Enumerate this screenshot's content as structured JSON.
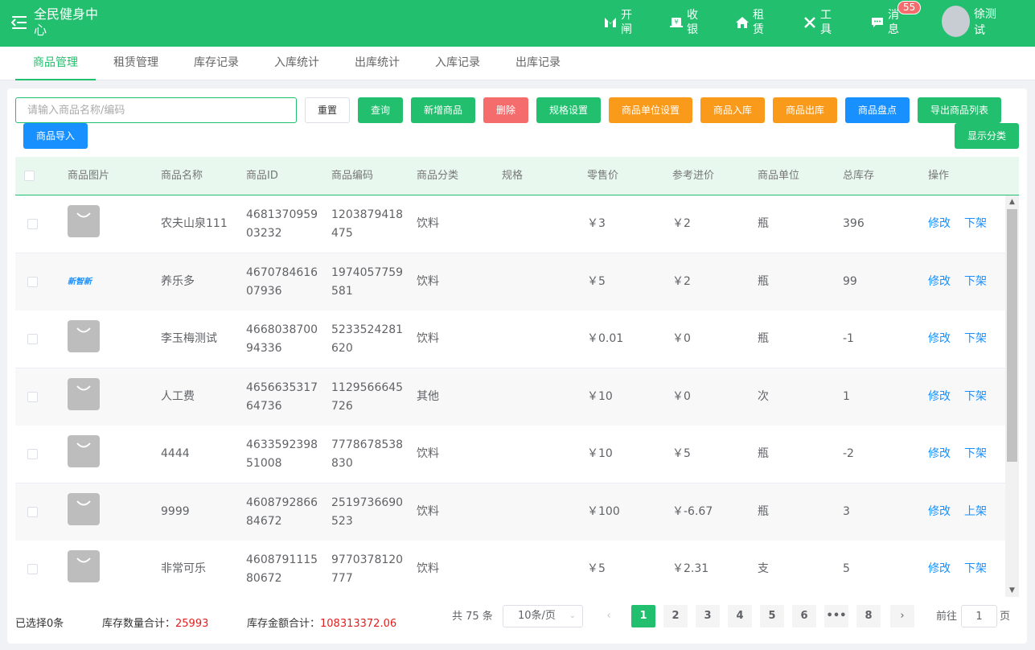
{
  "header": {
    "title": "全民健身中心",
    "nav": [
      {
        "label": "开闸",
        "icon": "gate-icon"
      },
      {
        "label": "收银",
        "icon": "cashier-icon"
      },
      {
        "label": "租赁",
        "icon": "home-icon"
      },
      {
        "label": "工具",
        "icon": "tools-icon"
      },
      {
        "label": "消息",
        "icon": "message-icon"
      }
    ],
    "message_badge": "55",
    "user_name": "徐测试"
  },
  "tabs": [
    {
      "label": "商品管理",
      "active": true
    },
    {
      "label": "租赁管理"
    },
    {
      "label": "库存记录"
    },
    {
      "label": "入库统计"
    },
    {
      "label": "出库统计"
    },
    {
      "label": "入库记录"
    },
    {
      "label": "出库记录"
    }
  ],
  "toolbar": {
    "search_placeholder": "请输入商品名称/编码",
    "search_value": "",
    "reset": "重置",
    "query": "查询",
    "add": "新增商品",
    "delete": "删除",
    "spec": "规格设置",
    "unit": "商品单位设置",
    "stock_in": "商品入库",
    "stock_out": "商品出库",
    "inventory": "商品盘点",
    "export": "导出商品列表",
    "import": "商品导入",
    "show_category": "显示分类"
  },
  "table": {
    "columns": [
      "商品图片",
      "商品名称",
      "商品ID",
      "商品编码",
      "商品分类",
      "规格",
      "零售价",
      "参考进价",
      "商品单位",
      "总库存",
      "操作"
    ],
    "rows": [
      {
        "name": "农夫山泉111",
        "id": "468137095903232",
        "code": "1203879418475",
        "category": "饮料",
        "spec": "",
        "price": "￥3",
        "cost": "￥2",
        "unit": "瓶",
        "stock": "396",
        "edit": "修改",
        "shelf": "下架",
        "img": "bag"
      },
      {
        "name": "养乐多",
        "id": "467078461607936",
        "code": "1974057759581",
        "category": "饮料",
        "spec": "",
        "price": "￥5",
        "cost": "￥2",
        "unit": "瓶",
        "stock": "99",
        "edit": "修改",
        "shelf": "下架",
        "img": "logo",
        "logo_text": "新智新"
      },
      {
        "name": "李玉梅测试",
        "id": "466803870094336",
        "code": "5233524281620",
        "category": "饮料",
        "spec": "",
        "price": "￥0.01",
        "cost": "￥0",
        "unit": "瓶",
        "stock": "-1",
        "edit": "修改",
        "shelf": "下架",
        "img": "bag"
      },
      {
        "name": "人工费",
        "id": "465663531764736",
        "code": "1129566645726",
        "category": "其他",
        "spec": "",
        "price": "￥10",
        "cost": "￥0",
        "unit": "次",
        "stock": "1",
        "edit": "修改",
        "shelf": "下架",
        "img": "bag"
      },
      {
        "name": "4444",
        "id": "463359239851008",
        "code": "7778678538830",
        "category": "饮料",
        "spec": "",
        "price": "￥10",
        "cost": "￥5",
        "unit": "瓶",
        "stock": "-2",
        "edit": "修改",
        "shelf": "下架",
        "img": "bag"
      },
      {
        "name": "9999",
        "id": "460879286684672",
        "code": "2519736690523",
        "category": "饮料",
        "spec": "",
        "price": "￥100",
        "cost": "￥-6.67",
        "unit": "瓶",
        "stock": "3",
        "edit": "修改",
        "shelf": "上架",
        "img": "bag"
      },
      {
        "name": "非常可乐",
        "id": "460879111580672",
        "code": "9770378120777",
        "category": "饮料",
        "spec": "",
        "price": "￥5",
        "cost": "￥2.31",
        "unit": "支",
        "stock": "5",
        "edit": "修改",
        "shelf": "下架",
        "img": "bag"
      }
    ]
  },
  "footer": {
    "selected": "已选择0条",
    "qty_label": "库存数量合计：",
    "qty_value": "25993",
    "amount_label": "库存金额合计：",
    "amount_value": "108313372.06"
  },
  "pagination": {
    "total": "共 75 条",
    "page_size": "10条/页",
    "pages": [
      "1",
      "2",
      "3",
      "4",
      "5",
      "6",
      "•••",
      "8"
    ],
    "current": "1",
    "goto_label": "前往",
    "goto_value": "1",
    "goto_suffix": "页"
  },
  "colors": {
    "primary": "#22bf6e",
    "danger": "#f56c6c",
    "warning": "#fa9a1b",
    "info": "#1890ff"
  }
}
